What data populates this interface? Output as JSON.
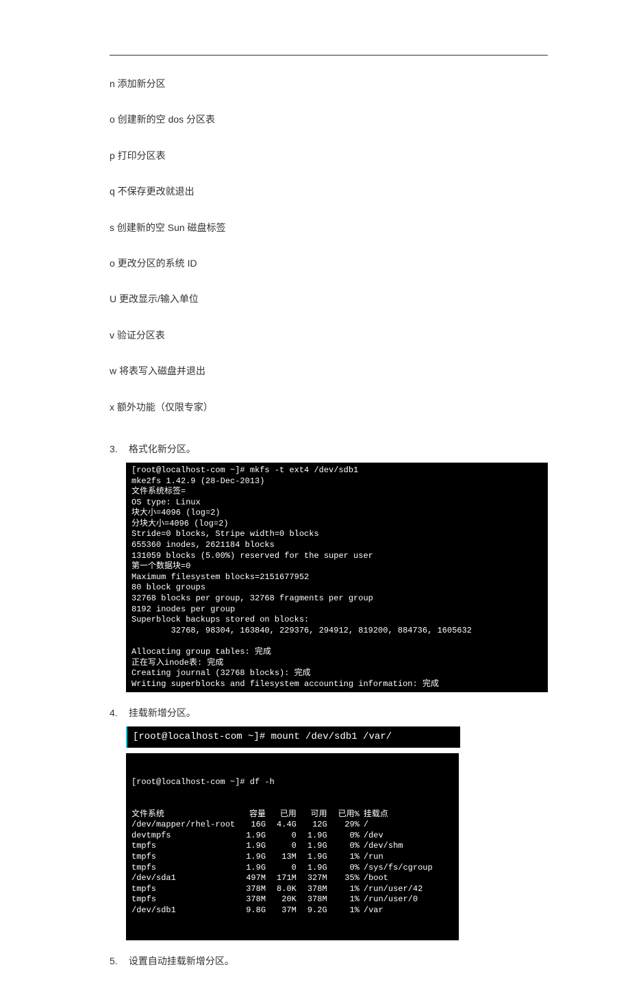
{
  "options": [
    "n 添加新分区",
    "o 创建新的空 dos 分区表",
    "p 打印分区表",
    "q 不保存更改就退出",
    "s 创建新的空 Sun 磁盘标签",
    "o 更改分区的系统 ID",
    "U 更改显示/输入单位",
    "v 验证分区表",
    "w 将表写入磁盘并退出",
    "x 额外功能（仅限专家）"
  ],
  "steps": {
    "s3": {
      "num": "3.",
      "text": "格式化新分区。"
    },
    "s4": {
      "num": "4.",
      "text": "挂载新增分区。"
    },
    "s5": {
      "num": "5.",
      "text": "设置自动挂载新增分区。"
    }
  },
  "mkfs_output": "[root@localhost-com ~]# mkfs -t ext4 /dev/sdb1\nmke2fs 1.42.9 (28-Dec-2013)\n文件系统标签=\nOS type: Linux\n块大小=4096 (log=2)\n分块大小=4096 (log=2)\nStride=0 blocks, Stripe width=0 blocks\n655360 inodes, 2621184 blocks\n131059 blocks (5.00%) reserved for the super user\n第一个数据块=0\nMaximum filesystem blocks=2151677952\n80 block groups\n32768 blocks per group, 32768 fragments per group\n8192 inodes per group\nSuperblock backups stored on blocks:\n        32768, 98304, 163840, 229376, 294912, 819200, 884736, 1605632\n\nAllocating group tables: 完成\n正在写入inode表: 完成\nCreating journal (32768 blocks): 完成\nWriting superblocks and filesystem accounting information: 完成",
  "mount_cmd": "[root@localhost-com ~]# mount /dev/sdb1 /var/",
  "df_cmd": "[root@localhost-com ~]# df -h",
  "df_header": {
    "fs": "文件系统",
    "size": "容量",
    "used": "已用",
    "avail": "可用",
    "usep": "已用%",
    "mount": "挂载点"
  },
  "df_rows": [
    {
      "fs": "/dev/mapper/rhel-root",
      "size": "16G",
      "used": "4.4G",
      "avail": "12G",
      "usep": "29%",
      "mount": "/"
    },
    {
      "fs": "devtmpfs",
      "size": "1.9G",
      "used": "0",
      "avail": "1.9G",
      "usep": "0%",
      "mount": "/dev"
    },
    {
      "fs": "tmpfs",
      "size": "1.9G",
      "used": "0",
      "avail": "1.9G",
      "usep": "0%",
      "mount": "/dev/shm"
    },
    {
      "fs": "tmpfs",
      "size": "1.9G",
      "used": "13M",
      "avail": "1.9G",
      "usep": "1%",
      "mount": "/run"
    },
    {
      "fs": "tmpfs",
      "size": "1.9G",
      "used": "0",
      "avail": "1.9G",
      "usep": "0%",
      "mount": "/sys/fs/cgroup"
    },
    {
      "fs": "/dev/sda1",
      "size": "497M",
      "used": "171M",
      "avail": "327M",
      "usep": "35%",
      "mount": "/boot"
    },
    {
      "fs": "tmpfs",
      "size": "378M",
      "used": "8.0K",
      "avail": "378M",
      "usep": "1%",
      "mount": "/run/user/42"
    },
    {
      "fs": "tmpfs",
      "size": "378M",
      "used": "20K",
      "avail": "378M",
      "usep": "1%",
      "mount": "/run/user/0"
    },
    {
      "fs": "/dev/sdb1",
      "size": "9.8G",
      "used": "37M",
      "avail": "9.2G",
      "usep": "1%",
      "mount": "/var"
    }
  ]
}
